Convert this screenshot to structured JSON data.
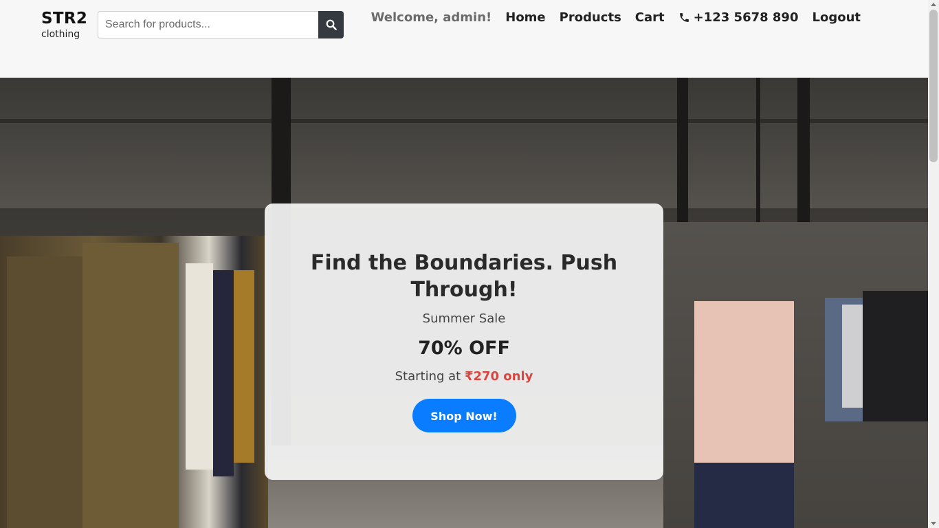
{
  "header": {
    "brand_name": "STR2",
    "brand_sub": "clothing",
    "search_placeholder": "Search for products...",
    "search_icon": "magnifier-icon"
  },
  "nav": {
    "welcome": "Welcome, admin!",
    "home": "Home",
    "products": "Products",
    "cart": "Cart",
    "phone_icon": "phone-icon",
    "phone": "+123 5678 890",
    "logout": "Logout"
  },
  "hero": {
    "headline": "Find the Boundaries. Push Through!",
    "subtitle": "Summer Sale",
    "discount": "70% OFF",
    "starting_prefix": "Starting at ",
    "price": "₹270 only",
    "cta": "Shop Now!"
  },
  "colors": {
    "accent": "#0a7cff",
    "price": "#d9463f",
    "search_button": "#343a40"
  }
}
